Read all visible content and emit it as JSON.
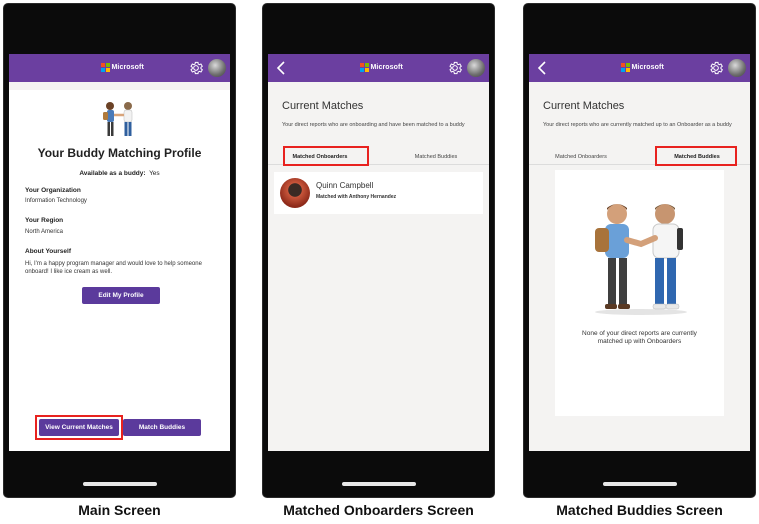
{
  "brand": {
    "name": "Microsoft",
    "accent": "#6b3fa0",
    "button": "#5b3a9c",
    "highlight": "#e8221f"
  },
  "main": {
    "title": "Your Buddy Matching Profile",
    "available_label": "Available as a buddy:",
    "available_value": "Yes",
    "org_label": "Your Organization",
    "org_value": "Information Technology",
    "region_label": "Your Region",
    "region_value": "North America",
    "about_label": "About Yourself",
    "about_value": "Hi, I'm a happy program manager and would love to help someone onboard! I like ice cream as well.",
    "edit_button": "Edit My Profile",
    "view_matches_button": "View Current Matches",
    "match_buddies_button": "Match Buddies"
  },
  "onboarders": {
    "title": "Current Matches",
    "subtitle": "Your direct reports who are onboarding and have been matched to a buddy",
    "tab_onboarders": "Matched Onboarders",
    "tab_buddies": "Matched Buddies",
    "active_tab": "Matched Onboarders",
    "match": {
      "name": "Quinn Campbell",
      "detail": "Matched with Anthony Hernandez"
    }
  },
  "buddies": {
    "title": "Current Matches",
    "subtitle": "Your direct reports who are currently matched up to an Onboarder as a buddy",
    "tab_onboarders": "Matched Onboarders",
    "tab_buddies": "Matched Buddies",
    "active_tab": "Matched Buddies",
    "empty_message": "None of your direct reports are currently matched up with Onboarders"
  },
  "captions": {
    "main": "Main Screen",
    "onboarders": "Matched Onboarders Screen",
    "buddies": "Matched Buddies Screen"
  },
  "icons": [
    "microsoft-logo-icon",
    "gear-icon",
    "back-chevron-icon",
    "avatar",
    "handshake-illustration"
  ]
}
